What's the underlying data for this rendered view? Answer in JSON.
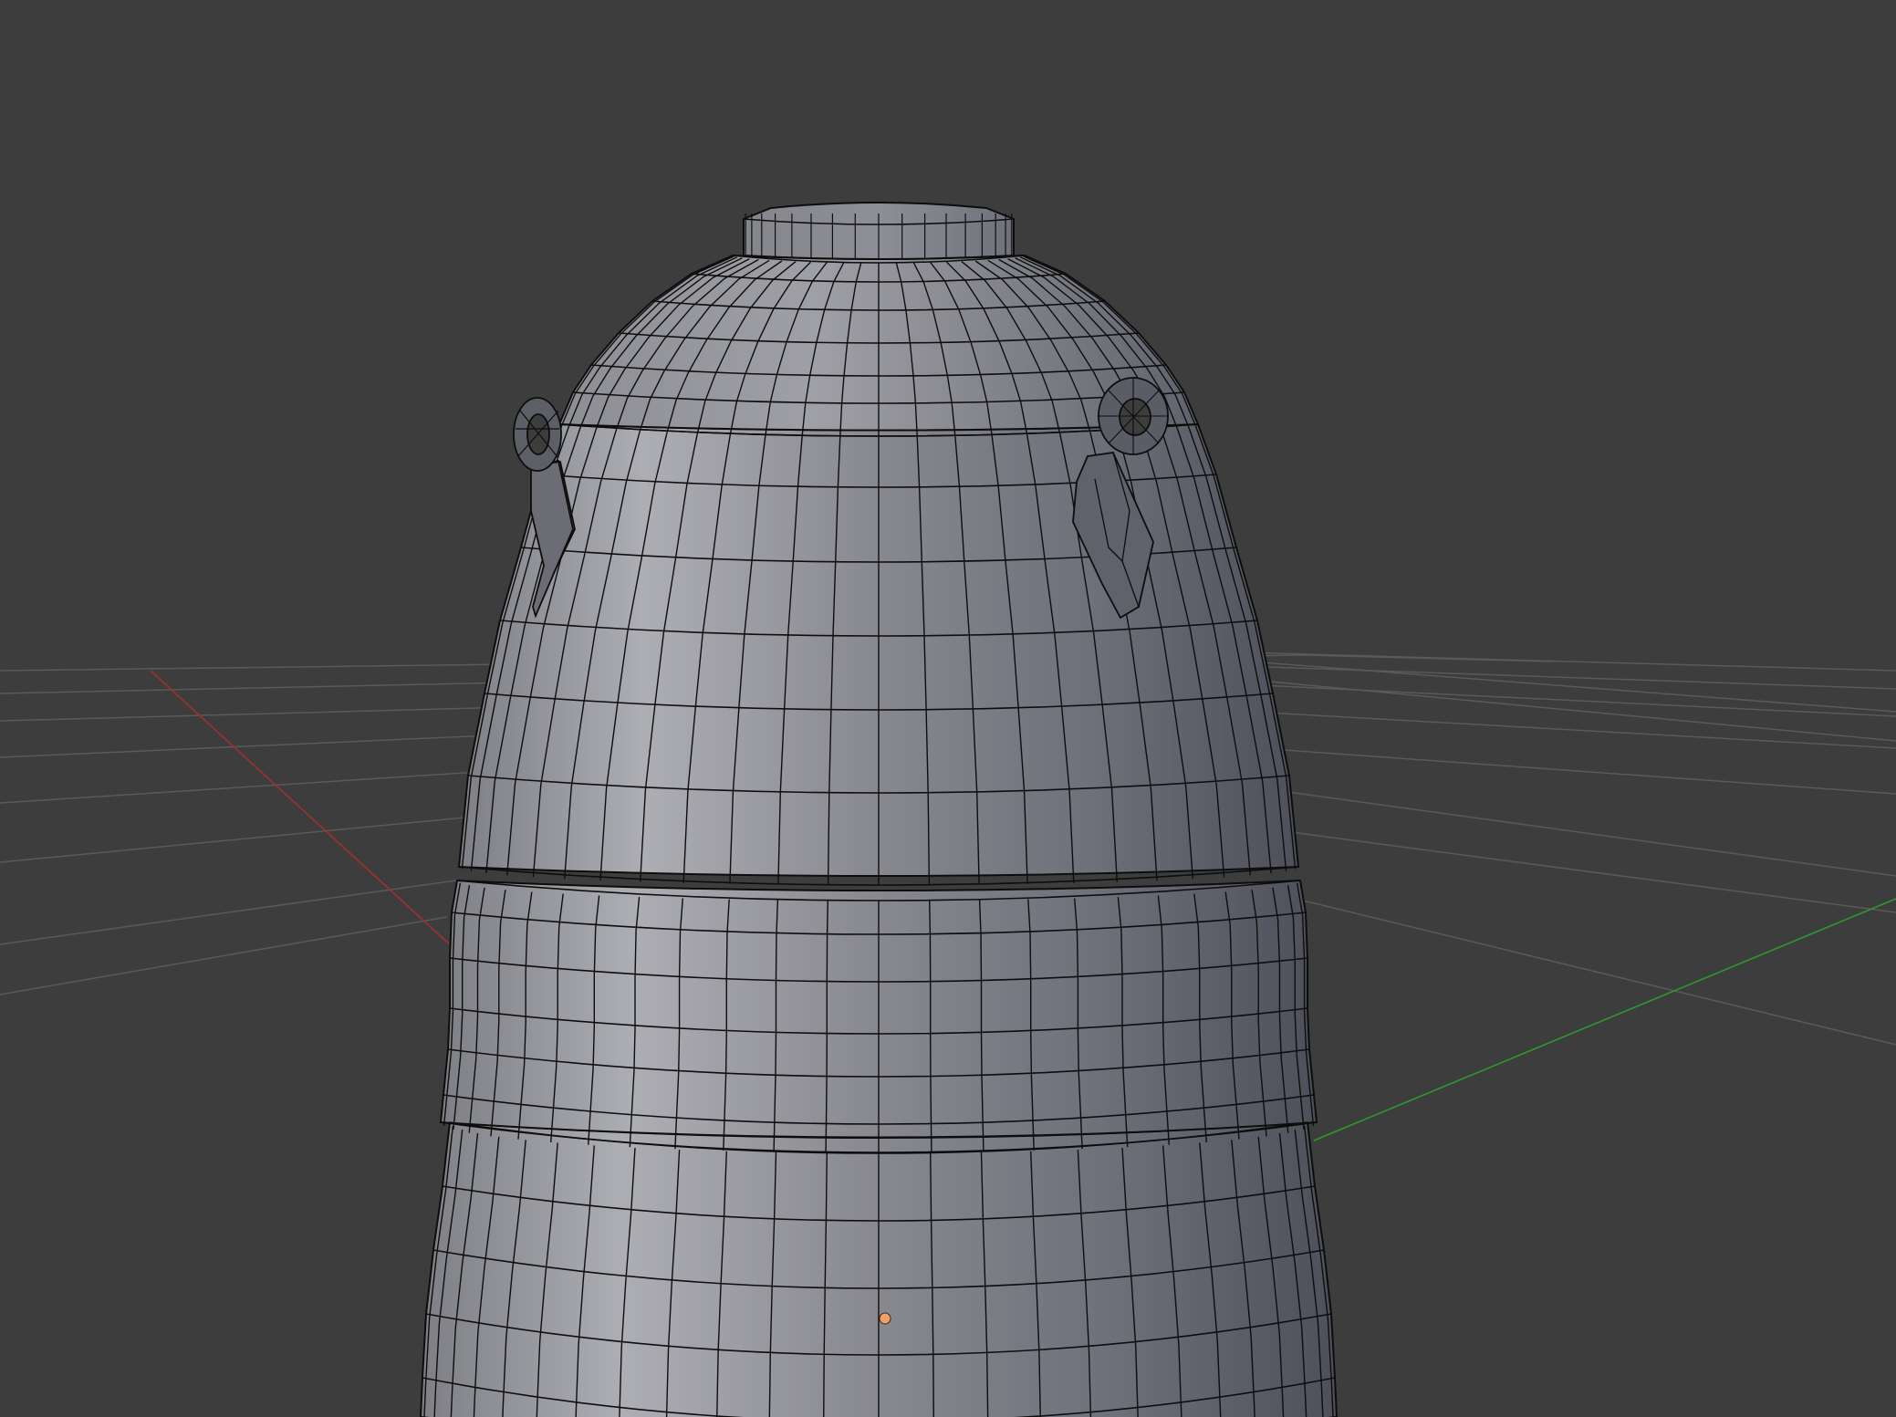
{
  "viewport": {
    "mode": "3D Viewport",
    "shading": "solid-wireframe",
    "background_color": "#3d3d3d",
    "grid_color": "#5a5a5a",
    "x_axis_color": "#a03030",
    "y_axis_color": "#2e9a2e",
    "mesh_color": "#8e9099",
    "edge_color": "#0d0d0d",
    "origin_color": "#f0a060"
  },
  "scene": {
    "object": {
      "name": "",
      "type": "mesh",
      "features": [
        "top-neck",
        "dome",
        "lifting-eye-left",
        "lifting-eye-right",
        "upper-band",
        "lower-band"
      ]
    }
  }
}
